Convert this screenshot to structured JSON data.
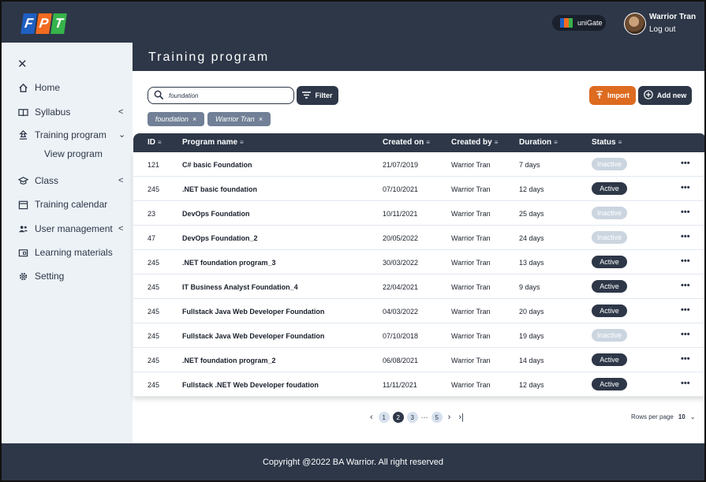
{
  "header": {
    "logo_letters": [
      "F",
      "P",
      "T"
    ],
    "unigate_label": "uniGate",
    "user_name": "Warrior Tran",
    "logout_label": "Log out"
  },
  "sidebar": {
    "close_icon": "close-icon",
    "items": [
      {
        "label": "Home",
        "icon": "home-icon"
      },
      {
        "label": "Syllabus",
        "icon": "book-icon"
      },
      {
        "label": "Training program",
        "icon": "training-icon"
      },
      {
        "label": "Class",
        "icon": "graduation-cap-icon"
      },
      {
        "label": "Training calendar",
        "icon": "calendar-icon"
      },
      {
        "label": "User management",
        "icon": "users-icon"
      },
      {
        "label": "Learning materials",
        "icon": "folder-icon"
      },
      {
        "label": "Setting",
        "icon": "gear-icon"
      }
    ],
    "sub_item": "View program"
  },
  "main": {
    "title": "Training program",
    "search_value": "foundation",
    "filter_label": "Filter",
    "chips": [
      "foundation",
      "Warrior Tran"
    ],
    "import_label": "Import",
    "addnew_label": "Add new"
  },
  "table": {
    "headers": [
      "ID",
      "Program name",
      "Created on",
      "Created by",
      "Duration",
      "Status"
    ],
    "rows": [
      {
        "id": "121",
        "name": "C# basic Foundation",
        "created_on": "21/07/2019",
        "created_by": "Warrior Tran",
        "duration": "7 days",
        "status": "Inactive"
      },
      {
        "id": "245",
        "name": ".NET basic foundation",
        "created_on": "07/10/2021",
        "created_by": "Warrior Tran",
        "duration": "12 days",
        "status": "Active"
      },
      {
        "id": "23",
        "name": "DevOps Foundation",
        "created_on": "10/11/2021",
        "created_by": "Warrior Tran",
        "duration": "25 days",
        "status": "Inactive"
      },
      {
        "id": "47",
        "name": "DevOps Foundation_2",
        "created_on": "20/05/2022",
        "created_by": "Warrior Tran",
        "duration": "24 days",
        "status": "Inactive"
      },
      {
        "id": "245",
        "name": ".NET foundation program_3",
        "created_on": "30/03/2022",
        "created_by": "Warrior Tran",
        "duration": "13 days",
        "status": "Active"
      },
      {
        "id": "245",
        "name": "IT Business Analyst Foundation_4",
        "created_on": "22/04/2021",
        "created_by": "Warrior Tran",
        "duration": "9 days",
        "status": "Active"
      },
      {
        "id": "245",
        "name": "Fullstack Java Web Developer Foundation",
        "created_on": "04/03/2022",
        "created_by": "Warrior Tran",
        "duration": "20 days",
        "status": "Active"
      },
      {
        "id": "245",
        "name": "Fullstack Java Web Developer Foundation",
        "created_on": "07/10/2018",
        "created_by": "Warrior Tran",
        "duration": "19 days",
        "status": "Inactive"
      },
      {
        "id": "245",
        "name": ".NET foundation program_2",
        "created_on": "06/08/2021",
        "created_by": "Warrior Tran",
        "duration": "14 days",
        "status": "Active"
      },
      {
        "id": "245",
        "name": "Fullstack .NET Web Developer foudation",
        "created_on": "11/11/2021",
        "created_by": "Warrior Tran",
        "duration": "12 days",
        "status": "Active"
      }
    ],
    "more_icon": "more-horizontal-icon"
  },
  "pagination": {
    "pages": [
      "1",
      "2",
      "3",
      "5"
    ],
    "current": "2",
    "ellipsis": "···",
    "rows_per_page_label": "Rows per page",
    "rows_per_page_value": "10"
  },
  "footer": {
    "text": "Copyright @2022 BA Warrior. All right reserved"
  },
  "colors": {
    "primary": "#2d3748",
    "accent_orange": "#dd6b20",
    "sidebar_bg": "#edf2f7",
    "inactive_badge": "#cbd5e0"
  }
}
